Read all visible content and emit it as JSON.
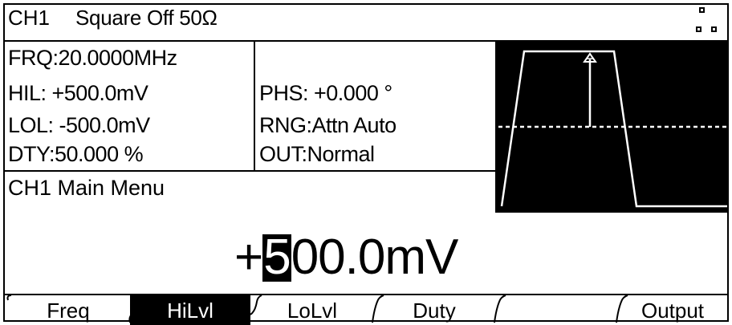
{
  "header": {
    "channel": "CH1",
    "status": "Square Off 50Ω"
  },
  "params": {
    "frequency": "FRQ:20.0000MHz",
    "high_level": "HIL:  +500.0mV",
    "low_level": "LOL: -500.0mV",
    "duty": "DTY:50.000 %",
    "phase": "PHS: +0.000 °",
    "range": "RNG:Attn Auto",
    "output_mode": "OUT:Normal"
  },
  "menu": {
    "title": "CH1 Main Menu"
  },
  "entry": {
    "sign": "+",
    "cursor_digit": "5",
    "rest": "00.0mV"
  },
  "softkeys": [
    {
      "label": "Freq",
      "active": false
    },
    {
      "label": "HiLvl",
      "active": true
    },
    {
      "label": "LoLvl",
      "active": false
    },
    {
      "label": "Duty",
      "active": false
    },
    {
      "label": "",
      "active": false
    },
    {
      "label": "Output",
      "active": false
    }
  ],
  "waveform": {
    "type": "square",
    "background": "#000000",
    "trace_color": "#ffffff",
    "edited_parameter": "high-level"
  }
}
